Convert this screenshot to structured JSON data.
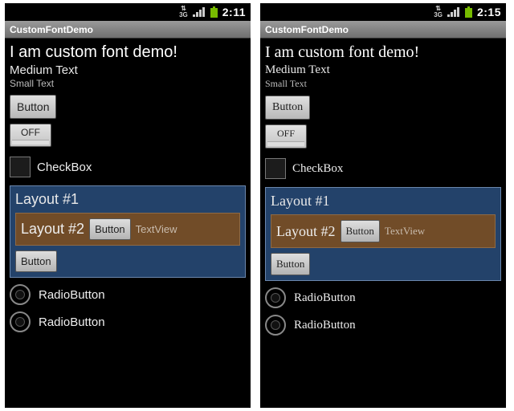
{
  "left": {
    "status": {
      "time": "2:11"
    },
    "title": "CustomFontDemo",
    "heading_large": "I am custom font demo!",
    "heading_medium": "Medium Text",
    "heading_small": "Small Text",
    "button1": "Button",
    "toggle": "OFF",
    "checkbox_label": "CheckBox",
    "panel1_title": "Layout #1",
    "panel2_title": "Layout #2",
    "panel2_button": "Button",
    "panel2_textview": "TextView",
    "panel1_button": "Button",
    "radio1": "RadioButton",
    "radio2": "RadioButton"
  },
  "right": {
    "status": {
      "time": "2:15"
    },
    "title": "CustomFontDemo",
    "heading_large": "I am custom font demo!",
    "heading_medium": "Medium Text",
    "heading_small": "Small Text",
    "button1": "Button",
    "toggle": "OFF",
    "checkbox_label": "CheckBox",
    "panel1_title": "Layout #1",
    "panel2_title": "Layout #2",
    "panel2_button": "Button",
    "panel2_textview": "TextView",
    "panel1_button": "Button",
    "radio1": "RadioButton",
    "radio2": "RadioButton"
  }
}
